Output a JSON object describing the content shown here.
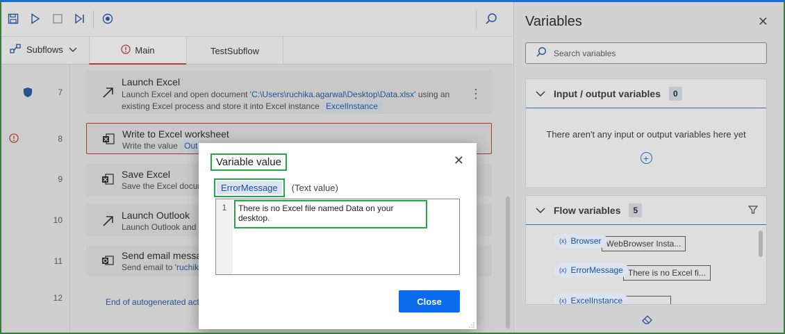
{
  "toolbar": {
    "icons": [
      "save-icon",
      "play-icon",
      "stop-icon",
      "step-icon",
      "record-icon",
      "search-icon"
    ]
  },
  "tabs": {
    "subflows_label": "Subflows",
    "items": [
      {
        "label": "Main",
        "active": true
      },
      {
        "label": "TestSubflow",
        "active": false
      }
    ]
  },
  "actions": [
    {
      "line": "7",
      "title": "Launch Excel",
      "desc_pre": "Launch Excel and open document '",
      "desc_path": "C:\\Users\\ruchika.agarwal\\Desktop\\Data.xlsx",
      "desc_mid": "' using an",
      "desc_line2": "existing Excel process and store it into Excel instance",
      "chip": "ExcelInstance"
    },
    {
      "line": "8",
      "title": "Write to Excel worksheet",
      "desc": "Write the value",
      "chip": "Out"
    },
    {
      "line": "9",
      "title": "Save Excel",
      "desc": "Save the Excel docum"
    },
    {
      "line": "10",
      "title": "Launch Outlook",
      "desc": "Launch Outlook and"
    },
    {
      "line": "11",
      "title": "Send email messa",
      "desc_pre": "Send email to '",
      "desc_path": "ruchik"
    },
    {
      "line": "12",
      "end_text": "End of autogenerated act"
    }
  ],
  "variables_panel": {
    "title": "Variables",
    "search_placeholder": "Search variables",
    "io_section": {
      "title": "Input / output variables",
      "count": "0",
      "empty_message": "There aren't any input or output variables here yet"
    },
    "flow_section": {
      "title": "Flow variables",
      "count": "5",
      "items": [
        {
          "name": "Browser",
          "value": "WebBrowser Insta..."
        },
        {
          "name": "ErrorMessage",
          "value": "There is no Excel fi..."
        },
        {
          "name": "ExcelInstance",
          "value": ""
        }
      ]
    }
  },
  "dialog": {
    "title": "Variable value",
    "variable_name": "ErrorMessage",
    "variable_type": "(Text value)",
    "line_number": "1",
    "value": "There is no Excel file named Data on your desktop.",
    "close_label": "Close"
  },
  "colors": {
    "accent": "#0b6cf0",
    "highlight": "#22a845",
    "chip_bg": "#dbe3ef",
    "error": "#b33333"
  }
}
